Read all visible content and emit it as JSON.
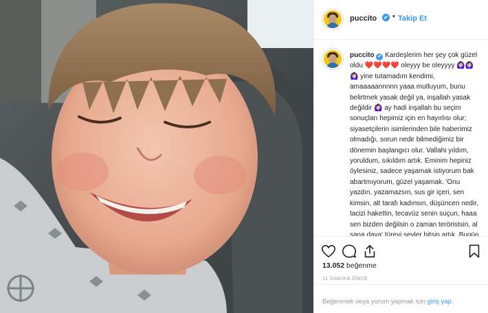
{
  "post": {
    "username": "puccito",
    "verified_mark": "✔",
    "separator": "•",
    "follow_label": "Takip Et",
    "caption_username": "puccito",
    "caption_text": " Kardeşlerim her şey çok güzel oldu ❤️❤️❤️❤️ oleyyy be oleyyyy 🙆🏻‍♀️🙆🏻‍♀️🙆🏻‍♀️ yine tutamadım kendimi, amaaaaannnnn yaaa mutluyum, bunu belirtmek yasak değil ya, inşallah yasak değildir 🙆🏻‍♀️ ay hadi inşallah bu seçim sonuçları hepimiz için en hayırlısı olur; siyasetçilerin isimlerinden bile haberimiz olmadığı, sorun nedir bilmediğimiz bir dönemin başlangıcı olur. Vallahi yıldım, yoruldum, sıkıldım artık. Eminim hepiniz öylesiniz, sadece yaşamak istiyorum bak abartmıyorum, güzel yaşamak. 'Onu yazdın, yazamazsın, sus gir içeri, sen kimsin, alt tarafı kadınsın, düşüncen nedir, tacizi hakettin, tecavüz senin suçun, haaa sen bizden değilsin o zaman teröristsin, al sana dava' türevi şeyler bitsin artık. Bugün"
  },
  "actions": {
    "like_icon": "heart-outline",
    "comment_icon": "speech-bubble",
    "share_icon": "share-arrow",
    "save_icon": "bookmark-outline",
    "likes_count": "13.052",
    "likes_suffix": " beğenme",
    "time_ago": "11 DAKİKA ÖNCE"
  },
  "footer": {
    "prompt_text": "Beğenmek veya yorum yapmak için ",
    "login_link": "giriş yap",
    "end_punct": "."
  },
  "colors": {
    "link": "#3897f0",
    "verified": "#3897f0",
    "border": "#efefef",
    "muted": "#999999",
    "avatar_bg": "#f5c518"
  }
}
